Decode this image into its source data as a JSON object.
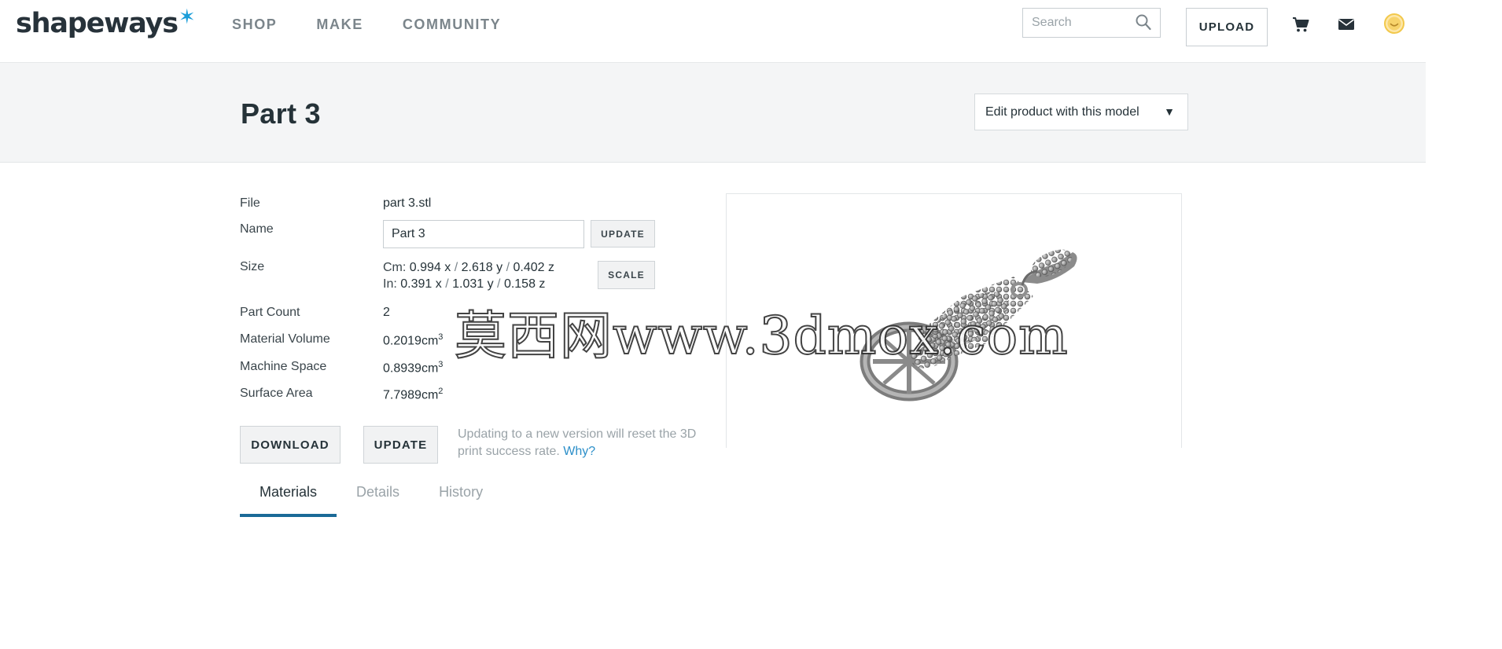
{
  "header": {
    "logo_text": "shapeways",
    "nav": [
      "SHOP",
      "MAKE",
      "COMMUNITY"
    ],
    "search_placeholder": "Search",
    "upload_label": "UPLOAD",
    "icons": [
      "search-icon",
      "cart-icon",
      "mail-icon",
      "avatar"
    ],
    "accent_color": "#1a9dd9"
  },
  "title_bar": {
    "title": "Part 3",
    "edit_select": "Edit product with this model"
  },
  "details": {
    "file_label": "File",
    "file_value": "part 3.stl",
    "name_label": "Name",
    "name_value": "Part 3",
    "name_update": "UPDATE",
    "size_label": "Size",
    "size_cm": {
      "prefix": "Cm:",
      "x": "0.994 x",
      "y": "2.618 y",
      "z": "0.402 z"
    },
    "size_in": {
      "prefix": "In:",
      "x": "0.391 x",
      "y": "1.031 y",
      "z": "0.158 z"
    },
    "size_sep": "/",
    "scale_label": "SCALE",
    "part_count_label": "Part Count",
    "part_count_value": "2",
    "material_volume_label": "Material Volume",
    "material_volume_value": "0.2019cm",
    "material_volume_exp": "3",
    "machine_space_label": "Machine Space",
    "machine_space_value": "0.8939cm",
    "machine_space_exp": "3",
    "surface_area_label": "Surface Area",
    "surface_area_value": "7.7989cm",
    "surface_area_exp": "2"
  },
  "actions": {
    "download_label": "DOWNLOAD",
    "update_label": "UPDATE",
    "note_text": "Updating to a new version will reset the 3D print success rate.",
    "why_link": "Why?"
  },
  "tabs": [
    {
      "label": "Materials",
      "active": true
    },
    {
      "label": "Details",
      "active": false
    },
    {
      "label": "History",
      "active": false
    }
  ],
  "watermark": "莫西网www.3dmox.com"
}
